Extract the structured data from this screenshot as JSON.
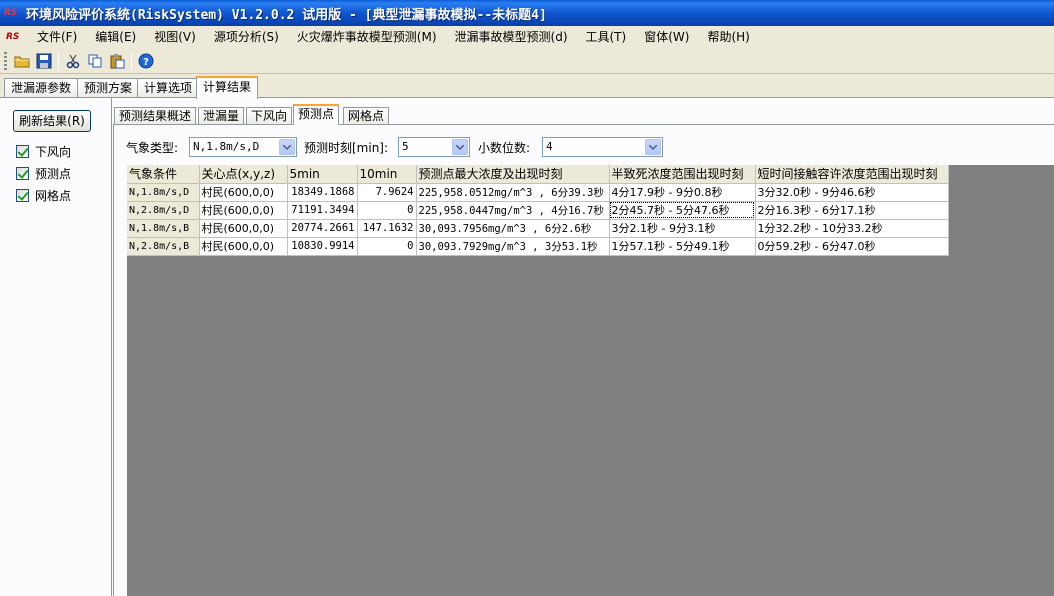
{
  "window": {
    "title": "环境风险评价系统(RiskSystem) V1.2.0.2 试用版 - [典型泄漏事故模拟--未标题4]",
    "icon_text": "RS"
  },
  "menu": {
    "logo_text": "RS",
    "items": [
      "文件(F)",
      "编辑(E)",
      "视图(V)",
      "源项分析(S)",
      "火灾爆炸事故模型预测(M)",
      "泄漏事故模型预测(d)",
      "工具(T)",
      "窗体(W)",
      "帮助(H)"
    ]
  },
  "toolbar": {
    "buttons": [
      "open-folder-icon",
      "save-icon",
      "cut-icon",
      "copy-icon",
      "paste-icon",
      "help-icon"
    ],
    "colors": {
      "folder": "#e8b830",
      "save": "#2a5ab8",
      "help": "#1f66d6"
    }
  },
  "tabs": {
    "main": [
      "泄漏源参数",
      "预测方案",
      "计算选项",
      "计算结果"
    ],
    "main_active": "计算结果",
    "sub": [
      "预测结果概述",
      "泄漏量",
      "下风向",
      "预测点",
      "网格点"
    ],
    "sub_active": "预测点"
  },
  "left": {
    "refresh_button": "刷新结果(R)",
    "checkboxes": [
      {
        "label": "下风向",
        "checked": true
      },
      {
        "label": "预测点",
        "checked": true
      },
      {
        "label": "网格点",
        "checked": true
      }
    ]
  },
  "controls": {
    "weather_label": "气象类型:",
    "weather_value": "N,1.8m/s,D",
    "time_label": "预测时刻[min]:",
    "time_value": "5",
    "decimals_label": "小数位数:",
    "decimals_value": "4"
  },
  "grid": {
    "columns": [
      "气象条件",
      "关心点(x,y,z)",
      "5min",
      "10min",
      "预测点最大浓度及出现时刻",
      "半致死浓度范围出现时刻",
      "短时间接触容许浓度范围出现时刻"
    ],
    "rows": [
      [
        "N,1.8m/s,D",
        "村民(600,0,0)",
        "18349.1868",
        "7.9624",
        "225,958.0512mg/m^3 , 6分39.3秒",
        "4分17.9秒 - 9分0.8秒",
        "3分32.0秒 - 9分46.6秒"
      ],
      [
        "N,2.8m/s,D",
        "村民(600,0,0)",
        "71191.3494",
        "0",
        "225,958.0447mg/m^3 , 4分16.7秒",
        "2分45.7秒 - 5分47.6秒",
        "2分16.3秒 - 6分17.1秒"
      ],
      [
        "N,1.8m/s,B",
        "村民(600,0,0)",
        "20774.2661",
        "147.1632",
        "30,093.7956mg/m^3 , 6分2.6秒",
        "3分2.1秒 - 9分3.1秒",
        "1分32.2秒 - 10分33.2秒"
      ],
      [
        "N,2.8m/s,B",
        "村民(600,0,0)",
        "10830.9914",
        "0",
        "30,093.7929mg/m^3 , 3分53.1秒",
        "1分57.1秒 - 5分49.1秒",
        "0分59.2秒 - 6分47.0秒"
      ]
    ]
  }
}
